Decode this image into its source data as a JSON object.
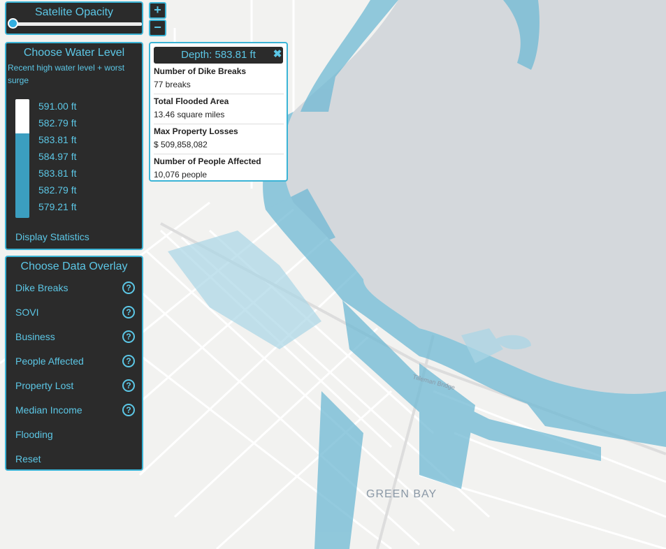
{
  "map": {
    "city_label": "GREEN BAY",
    "bridge_label": "Tilleman Bridge"
  },
  "opacity": {
    "title": "Satelite Opacity",
    "value": 0
  },
  "zoom": {
    "in": "+",
    "out": "−"
  },
  "water": {
    "title": "Choose Water Level",
    "subtitle": "Recent high water level + worst surge",
    "levels": [
      "591.00 ft",
      "582.79 ft",
      "583.81 ft",
      "584.97 ft",
      "583.81 ft",
      "582.79 ft",
      "579.21 ft"
    ],
    "gauge_fill_fraction": 0.29,
    "display_stats": "Display Statistics"
  },
  "overlay": {
    "title": "Choose Data Overlay",
    "items": [
      {
        "label": "Dike Breaks",
        "help": true
      },
      {
        "label": "SOVI",
        "help": true
      },
      {
        "label": "Business",
        "help": true
      },
      {
        "label": "People Affected",
        "help": true
      },
      {
        "label": "Property Lost",
        "help": true
      },
      {
        "label": "Median Income",
        "help": true
      },
      {
        "label": "Flooding",
        "help": false
      },
      {
        "label": "Reset",
        "help": false
      }
    ]
  },
  "popup": {
    "title": "Depth: 583.81 ft",
    "close": "✖",
    "stats": [
      {
        "label": "Number of Dike Breaks",
        "value": "77 breaks"
      },
      {
        "label": "Total Flooded Area",
        "value": "13.46 square miles"
      },
      {
        "label": "Max Property Losses",
        "value": "$ 509,858,082"
      },
      {
        "label": "Number of People Affected",
        "value": "10,076 people"
      }
    ]
  },
  "colors": {
    "accent": "#3bb4d6",
    "panel": "#2b2b2b",
    "water": "#d4d8dc",
    "flood": "#6fb9d4"
  }
}
